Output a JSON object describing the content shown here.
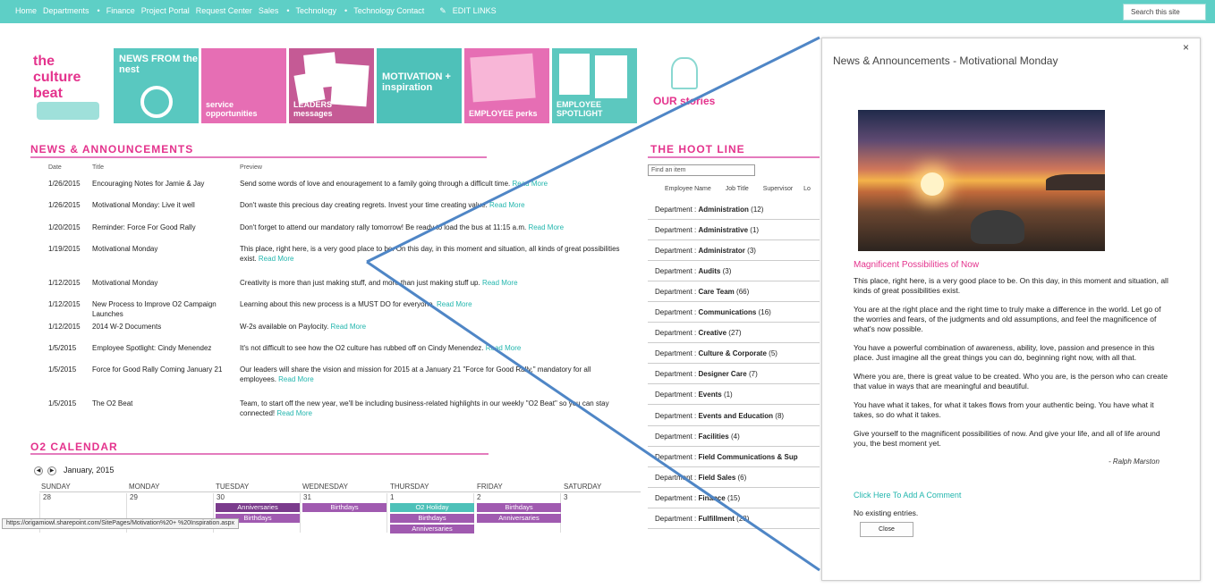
{
  "topnav": {
    "items": [
      "Home",
      "Departments",
      "Finance",
      "Project Portal",
      "Request Center",
      "Sales",
      "Technology",
      "Technology Contact"
    ],
    "edit": "EDIT LINKS",
    "search_placeholder": "Search this site"
  },
  "banner": {
    "culture_beat": "the culture beat",
    "tiles": [
      "NEWS FROM the nest",
      "service opportunities",
      "LEADERS' messages",
      "MOTIVATION + inspiration",
      "EMPLOYEE perks",
      "EMPLOYEE SPOTLIGHT",
      "OUR stories"
    ]
  },
  "news": {
    "title": "NEWS & ANNOUNCEMENTS",
    "columns": [
      "Date",
      "Title",
      "Preview"
    ],
    "rows": [
      {
        "date": "1/26/2015",
        "title": "Encouraging Notes for Jamie & Jay",
        "preview": "Send some words of love and enouragement to a family going through a difficult time. ",
        "more": "Read More"
      },
      {
        "date": "1/26/2015",
        "title": "Motivational Monday: Live it well",
        "preview": "Don't waste this precious day creating regrets. Invest your time creating value. ",
        "more": "Read More"
      },
      {
        "date": "1/20/2015",
        "title": "Reminder: Force For Good Rally",
        "preview": "Don't forget to attend our mandatory rally tomorrow! Be ready to load the bus at 11:15 a.m. ",
        "more": "Read More"
      },
      {
        "date": "1/19/2015",
        "title": "Motivational Monday",
        "preview": "This place, right here, is a very good place to be. On this day, in this moment and situation, all kinds of great possibilities exist. ",
        "more": "Read More"
      },
      {
        "date": "1/12/2015",
        "title": "Motivational Monday",
        "preview": "Creativity is more than just making stuff, and more than just making stuff up. ",
        "more": "Read More"
      },
      {
        "date": "1/12/2015",
        "title": "New Process to Improve O2 Campaign Launches",
        "preview": "Learning about this new process is a MUST DO for everyone. ",
        "more": "Read More"
      },
      {
        "date": "1/12/2015",
        "title": "2014 W-2 Documents",
        "preview": "W-2s available on Paylocity. ",
        "more": "Read More"
      },
      {
        "date": "1/5/2015",
        "title": "Employee Spotlight: Cindy Menendez",
        "preview": "It's not difficult to see how the O2 culture has rubbed off on Cindy Menendez. ",
        "more": "Read More"
      },
      {
        "date": "1/5/2015",
        "title": "Force for Good Rally Coming January 21",
        "preview": "Our leaders will share the vision and mission for 2015 at a January 21 \"Force for Good Rally,\" mandatory for all employees. ",
        "more": "Read More"
      },
      {
        "date": "1/5/2015",
        "title": "The O2 Beat",
        "preview": "Team, to start off the new year, we'll be including business-related highlights in our weekly \"O2 Beat\" so you can stay connected! ",
        "more": "Read More"
      }
    ]
  },
  "calendar": {
    "title": "O2 CALENDAR",
    "month": "January, 2015",
    "days": [
      "SUNDAY",
      "MONDAY",
      "TUESDAY",
      "WEDNESDAY",
      "THURSDAY",
      "FRIDAY",
      "SATURDAY"
    ],
    "dates": [
      "28",
      "29",
      "30",
      "31",
      "1",
      "2",
      "3"
    ],
    "events": {
      "tue": [
        "Anniversaries",
        "Birthdays"
      ],
      "wed": [
        "Birthdays"
      ],
      "thu": [
        "O2 Holiday",
        "Birthdays",
        "Anniversaries"
      ],
      "fri": [
        "Birthdays",
        "Anniversaries"
      ]
    }
  },
  "hoot": {
    "title": "THE HOOT LINE",
    "find_placeholder": "Find an item",
    "columns": [
      "Employee Name",
      "Job Title",
      "Supervisor",
      "Lo"
    ],
    "prefix": "Department : ",
    "rows": [
      {
        "name": "Administration",
        "count": "(12)"
      },
      {
        "name": "Administrative",
        "count": "(1)"
      },
      {
        "name": "Administrator",
        "count": "(3)"
      },
      {
        "name": "Audits",
        "count": "(3)"
      },
      {
        "name": "Care Team",
        "count": "(66)"
      },
      {
        "name": "Communications",
        "count": "(16)"
      },
      {
        "name": "Creative",
        "count": "(27)"
      },
      {
        "name": "Culture & Corporate",
        "count": "(5)"
      },
      {
        "name": "Designer Care",
        "count": "(7)"
      },
      {
        "name": "Events",
        "count": "(1)"
      },
      {
        "name": "Events and Education",
        "count": "(8)"
      },
      {
        "name": "Facilities",
        "count": "(4)"
      },
      {
        "name": "Field Communications & Sup",
        "count": ""
      },
      {
        "name": "Field Sales",
        "count": "(6)"
      },
      {
        "name": "Finance",
        "count": "(15)"
      },
      {
        "name": "Fulfillment",
        "count": "(28)"
      }
    ]
  },
  "modal": {
    "title": "News & Announcements - Motivational Monday",
    "close_x": "×",
    "heading": "Magnificent Possibilities of Now",
    "paragraphs": [
      "This place, right here, is a very good place to be. On this day, in this moment and situation, all kinds of great possibilities exist.",
      "You are at the right place and the right time to truly make a difference in the world. Let go of the worries and fears, of the judgments and old assumptions, and feel the magnificence of what's now possible.",
      "You have a powerful combination of awareness, ability, love, passion and presence in this place. Just imagine all the great things you can do, beginning right now, with all that.",
      "Where you are, there is great value to be created. Who you are, is the person who can create that value in ways that are meaningful and beautiful.",
      "You have what it takes, for what it takes flows from your authentic being. You have what it takes, so do what it takes.",
      "Give yourself to the magnificent possibilities of now. And give your life, and all of life around you, the best moment yet."
    ],
    "author": "- Ralph Marston",
    "comment_link": "Click Here To Add A Comment",
    "no_entries": "No existing entries.",
    "close_button": "Close"
  },
  "status_url": "https://origamiowl.sharepoint.com/SitePages/Motivation%20+ %20Inspiration.aspx"
}
